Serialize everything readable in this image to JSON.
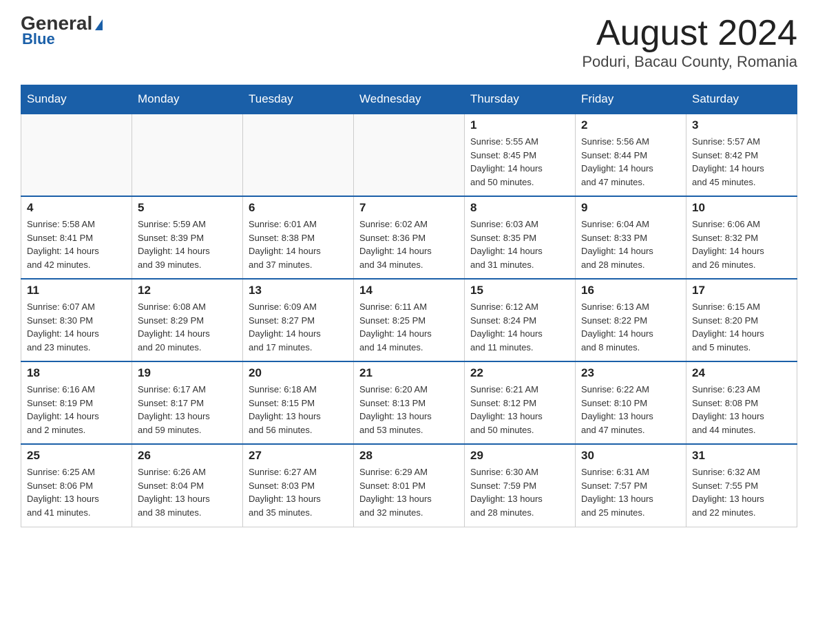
{
  "logo": {
    "general": "General",
    "blue": "Blue",
    "tagline": ""
  },
  "title": "August 2024",
  "subtitle": "Poduri, Bacau County, Romania",
  "header_days": [
    "Sunday",
    "Monday",
    "Tuesday",
    "Wednesday",
    "Thursday",
    "Friday",
    "Saturday"
  ],
  "weeks": [
    [
      {
        "day": "",
        "info": ""
      },
      {
        "day": "",
        "info": ""
      },
      {
        "day": "",
        "info": ""
      },
      {
        "day": "",
        "info": ""
      },
      {
        "day": "1",
        "info": "Sunrise: 5:55 AM\nSunset: 8:45 PM\nDaylight: 14 hours\nand 50 minutes."
      },
      {
        "day": "2",
        "info": "Sunrise: 5:56 AM\nSunset: 8:44 PM\nDaylight: 14 hours\nand 47 minutes."
      },
      {
        "day": "3",
        "info": "Sunrise: 5:57 AM\nSunset: 8:42 PM\nDaylight: 14 hours\nand 45 minutes."
      }
    ],
    [
      {
        "day": "4",
        "info": "Sunrise: 5:58 AM\nSunset: 8:41 PM\nDaylight: 14 hours\nand 42 minutes."
      },
      {
        "day": "5",
        "info": "Sunrise: 5:59 AM\nSunset: 8:39 PM\nDaylight: 14 hours\nand 39 minutes."
      },
      {
        "day": "6",
        "info": "Sunrise: 6:01 AM\nSunset: 8:38 PM\nDaylight: 14 hours\nand 37 minutes."
      },
      {
        "day": "7",
        "info": "Sunrise: 6:02 AM\nSunset: 8:36 PM\nDaylight: 14 hours\nand 34 minutes."
      },
      {
        "day": "8",
        "info": "Sunrise: 6:03 AM\nSunset: 8:35 PM\nDaylight: 14 hours\nand 31 minutes."
      },
      {
        "day": "9",
        "info": "Sunrise: 6:04 AM\nSunset: 8:33 PM\nDaylight: 14 hours\nand 28 minutes."
      },
      {
        "day": "10",
        "info": "Sunrise: 6:06 AM\nSunset: 8:32 PM\nDaylight: 14 hours\nand 26 minutes."
      }
    ],
    [
      {
        "day": "11",
        "info": "Sunrise: 6:07 AM\nSunset: 8:30 PM\nDaylight: 14 hours\nand 23 minutes."
      },
      {
        "day": "12",
        "info": "Sunrise: 6:08 AM\nSunset: 8:29 PM\nDaylight: 14 hours\nand 20 minutes."
      },
      {
        "day": "13",
        "info": "Sunrise: 6:09 AM\nSunset: 8:27 PM\nDaylight: 14 hours\nand 17 minutes."
      },
      {
        "day": "14",
        "info": "Sunrise: 6:11 AM\nSunset: 8:25 PM\nDaylight: 14 hours\nand 14 minutes."
      },
      {
        "day": "15",
        "info": "Sunrise: 6:12 AM\nSunset: 8:24 PM\nDaylight: 14 hours\nand 11 minutes."
      },
      {
        "day": "16",
        "info": "Sunrise: 6:13 AM\nSunset: 8:22 PM\nDaylight: 14 hours\nand 8 minutes."
      },
      {
        "day": "17",
        "info": "Sunrise: 6:15 AM\nSunset: 8:20 PM\nDaylight: 14 hours\nand 5 minutes."
      }
    ],
    [
      {
        "day": "18",
        "info": "Sunrise: 6:16 AM\nSunset: 8:19 PM\nDaylight: 14 hours\nand 2 minutes."
      },
      {
        "day": "19",
        "info": "Sunrise: 6:17 AM\nSunset: 8:17 PM\nDaylight: 13 hours\nand 59 minutes."
      },
      {
        "day": "20",
        "info": "Sunrise: 6:18 AM\nSunset: 8:15 PM\nDaylight: 13 hours\nand 56 minutes."
      },
      {
        "day": "21",
        "info": "Sunrise: 6:20 AM\nSunset: 8:13 PM\nDaylight: 13 hours\nand 53 minutes."
      },
      {
        "day": "22",
        "info": "Sunrise: 6:21 AM\nSunset: 8:12 PM\nDaylight: 13 hours\nand 50 minutes."
      },
      {
        "day": "23",
        "info": "Sunrise: 6:22 AM\nSunset: 8:10 PM\nDaylight: 13 hours\nand 47 minutes."
      },
      {
        "day": "24",
        "info": "Sunrise: 6:23 AM\nSunset: 8:08 PM\nDaylight: 13 hours\nand 44 minutes."
      }
    ],
    [
      {
        "day": "25",
        "info": "Sunrise: 6:25 AM\nSunset: 8:06 PM\nDaylight: 13 hours\nand 41 minutes."
      },
      {
        "day": "26",
        "info": "Sunrise: 6:26 AM\nSunset: 8:04 PM\nDaylight: 13 hours\nand 38 minutes."
      },
      {
        "day": "27",
        "info": "Sunrise: 6:27 AM\nSunset: 8:03 PM\nDaylight: 13 hours\nand 35 minutes."
      },
      {
        "day": "28",
        "info": "Sunrise: 6:29 AM\nSunset: 8:01 PM\nDaylight: 13 hours\nand 32 minutes."
      },
      {
        "day": "29",
        "info": "Sunrise: 6:30 AM\nSunset: 7:59 PM\nDaylight: 13 hours\nand 28 minutes."
      },
      {
        "day": "30",
        "info": "Sunrise: 6:31 AM\nSunset: 7:57 PM\nDaylight: 13 hours\nand 25 minutes."
      },
      {
        "day": "31",
        "info": "Sunrise: 6:32 AM\nSunset: 7:55 PM\nDaylight: 13 hours\nand 22 minutes."
      }
    ]
  ]
}
